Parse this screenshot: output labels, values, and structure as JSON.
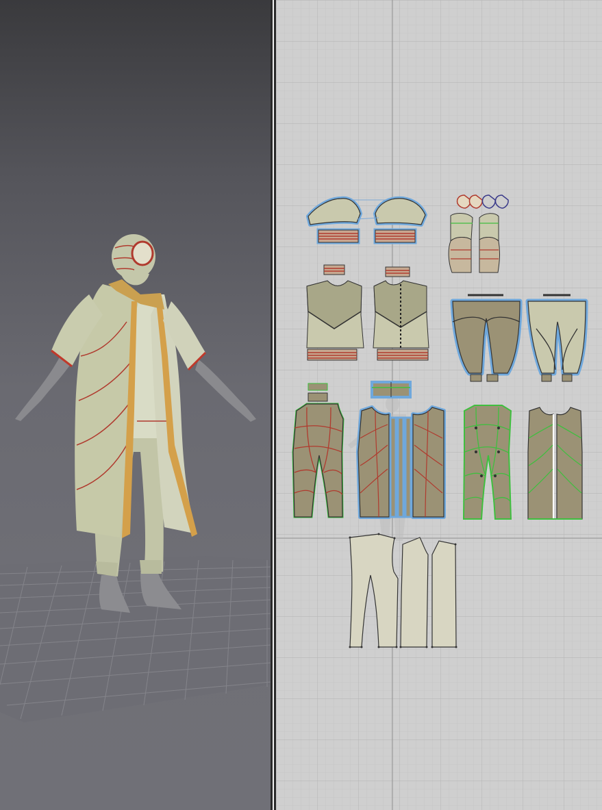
{
  "app": {
    "name": ""
  },
  "panels": {
    "avatar_3d": {
      "label": ""
    },
    "pattern_2d": {
      "label": ""
    }
  },
  "colors": {
    "viewport_3d_top": "#3a3a3d",
    "viewport_3d_bottom": "#707077",
    "viewport_2d_bg": "#cfcfcf",
    "fabric_sage": "#c9ccae",
    "fabric_shaded": "#9b9275",
    "fabric_light": "#d8d6c2",
    "stitch_red": "#b03a2e",
    "seam_green": "#3fbf3f",
    "selection_blue": "#6fa8dc",
    "trim_orange": "#d4a04a",
    "avatar_gray": "#8a8a8e"
  },
  "icons": [
    "pattern-piece-icon",
    "avatar-icon",
    "grid-floor-icon"
  ]
}
